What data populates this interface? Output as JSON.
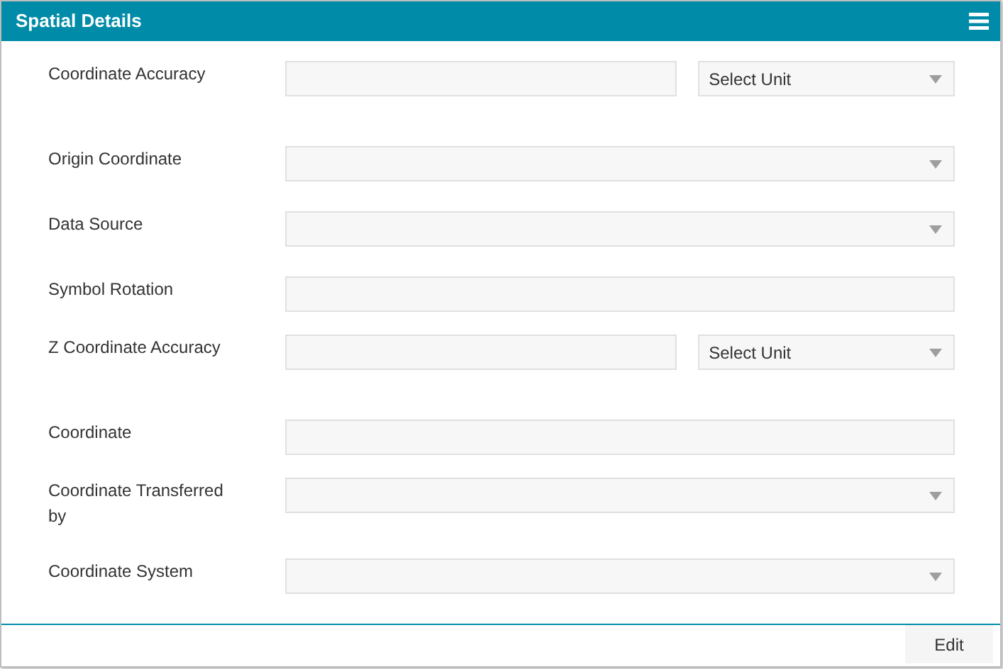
{
  "panel": {
    "title": "Spatial Details"
  },
  "fields": [
    {
      "label": "Coordinate Accuracy",
      "kind": "text_unit",
      "unit": "Select Unit"
    },
    {
      "label": "Origin Coordinate",
      "kind": "select"
    },
    {
      "label": "Data Source",
      "kind": "select"
    },
    {
      "label": "Symbol Rotation",
      "kind": "text"
    },
    {
      "label": "Z Coordinate Accuracy",
      "kind": "text_unit",
      "unit": "Select Unit"
    },
    {
      "label": "Coordinate",
      "kind": "text"
    },
    {
      "label": "Coordinate Transferred by",
      "kind": "select"
    },
    {
      "label": "Coordinate System",
      "kind": "select"
    }
  ],
  "buttons": [
    {
      "label": "Edit"
    }
  ]
}
